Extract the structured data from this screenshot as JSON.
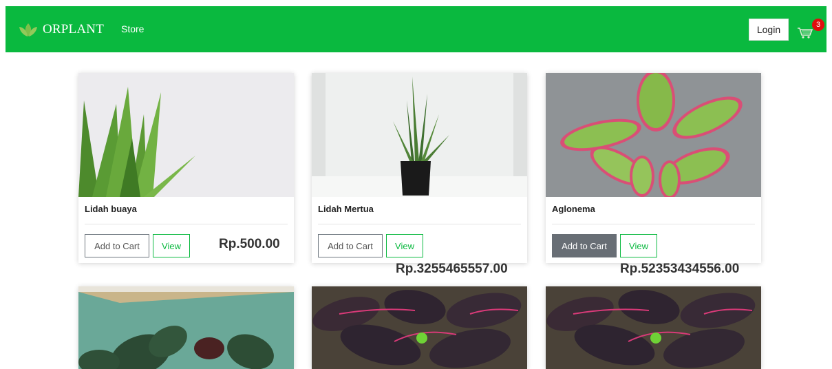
{
  "navbar": {
    "brand": "ORPLANT",
    "store_link": "Store",
    "login_label": "Login",
    "cart_count": "3"
  },
  "colors": {
    "brand_green": "#0ab93f",
    "badge_red": "#e00d0d",
    "button_gray": "#686e75"
  },
  "products": [
    {
      "name": "Lidah buaya",
      "price": "Rp.500.00",
      "add_label": "Add to Cart",
      "view_label": "View",
      "image": "aloe-vera-plant"
    },
    {
      "name": "Lidah Mertua",
      "price": "Rp.3255465557.00",
      "add_label": "Add to Cart",
      "view_label": "View",
      "image": "snake-plant-in-pot"
    },
    {
      "name": "Aglonema",
      "price": "Rp.52353434556.00",
      "add_label": "Add to Cart",
      "view_label": "View",
      "image": "aglaonema-plant"
    },
    {
      "image": "begonia-plant"
    },
    {
      "image": "calathea-plant"
    },
    {
      "image": "calathea-plant"
    }
  ]
}
